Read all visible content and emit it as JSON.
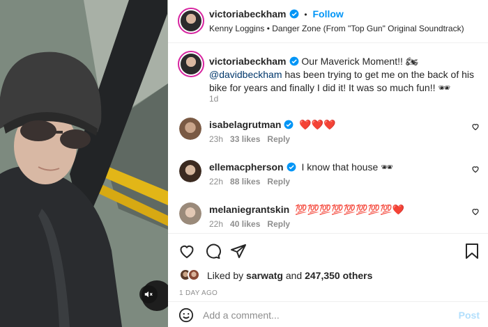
{
  "post": {
    "username": "victoriabeckham",
    "separator": "•",
    "follow_label": "Follow",
    "audio": "Kenny Loggins • Danger Zone (From \"Top Gun\" Original Soundtrack)"
  },
  "caption": {
    "username": "victoriabeckham",
    "text_before": "Our Maverick Moment!! 🏍 ",
    "mention": "@davidbeckham",
    "text_after": " has been trying to get me on the back of his bike for years and finally I did it! It was so much fun!! 🕶",
    "time": "1d"
  },
  "comments": [
    {
      "username": "isabelagrutman",
      "text": "❤️❤️❤️",
      "time": "23h",
      "likes": "33 likes",
      "reply": "Reply"
    },
    {
      "username": "ellemacpherson",
      "text": "I know that house 🕶",
      "time": "22h",
      "likes": "88 likes",
      "reply": "Reply"
    },
    {
      "username": "melaniegrantskin",
      "text": "💯💯💯💯💯💯💯💯❤️",
      "time": "22h",
      "likes": "40 likes",
      "reply": "Reply"
    }
  ],
  "likes": {
    "prefix": "Liked by",
    "user": "sarwatg",
    "middle": "and",
    "count": "247,350 others"
  },
  "date": "1 DAY AGO",
  "composer": {
    "placeholder": "Add a comment...",
    "post_label": "Post"
  },
  "icons": {
    "verified": "verified-badge-icon",
    "like": "heart-outline-icon",
    "comment": "speech-bubble-icon",
    "share": "paper-plane-icon",
    "save": "bookmark-icon",
    "emoji": "smiley-icon",
    "mute": "speaker-muted-icon"
  },
  "colors": {
    "accent": "#0095f6",
    "verified": "#0095f6",
    "mention": "#00376b",
    "muted_text": "#8e8e8e",
    "post_disabled": "#b2dffc"
  }
}
